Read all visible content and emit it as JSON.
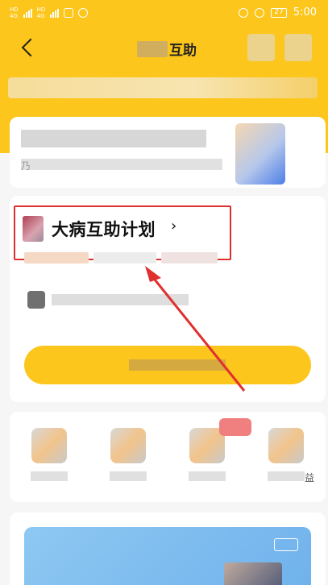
{
  "status_bar": {
    "left": [
      "HD",
      "4G",
      "HD",
      "4G"
    ],
    "battery": "27",
    "time": "5:00"
  },
  "nav": {
    "title": "互助"
  },
  "plan": {
    "title": "大病互助计划",
    "chevron": "›"
  },
  "card_1": {
    "prefix": "乃"
  },
  "services": {
    "last_suffix": "益"
  },
  "colors": {
    "brand_yellow": "#fcc61c",
    "highlight_red": "#e0302e"
  }
}
